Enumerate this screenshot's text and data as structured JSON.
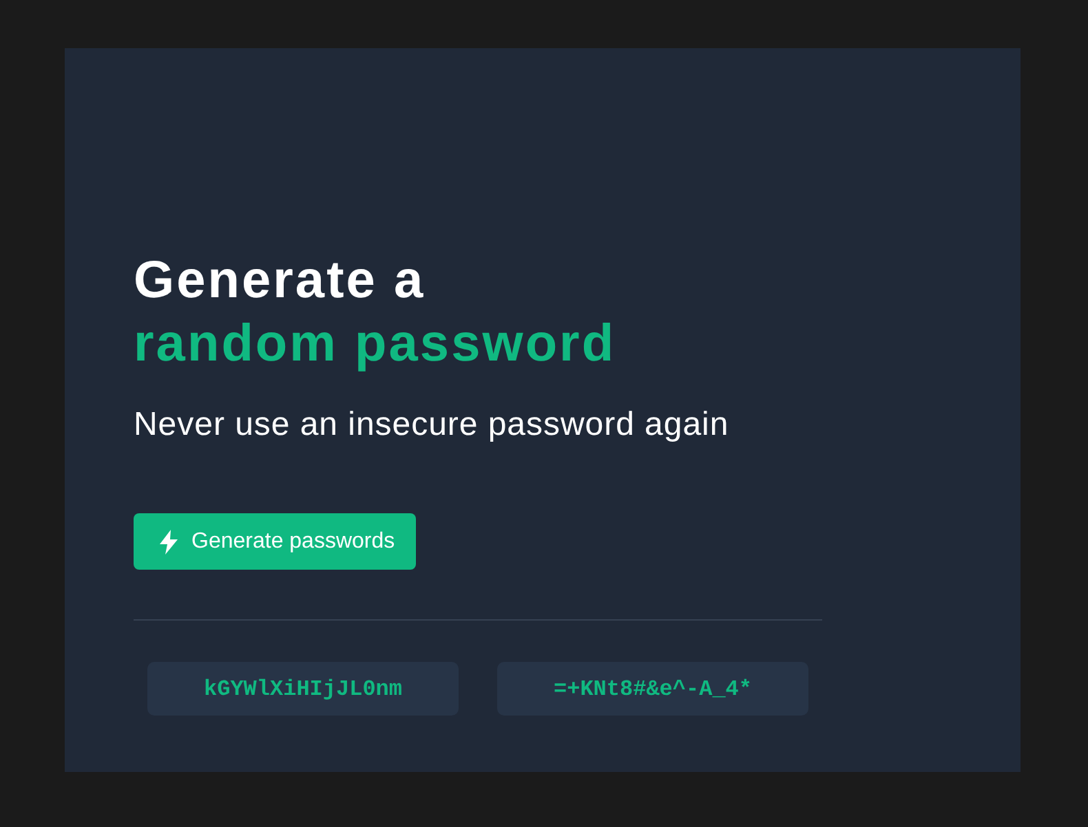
{
  "heading": {
    "line_1": "Generate a",
    "line_2": "random password"
  },
  "subtitle": "Never use an insecure password again",
  "generate_button": {
    "label": "Generate passwords"
  },
  "passwords": [
    "kGYWlXiHIjJL0nm",
    "=+KNt8#&e^-A_4*"
  ]
}
